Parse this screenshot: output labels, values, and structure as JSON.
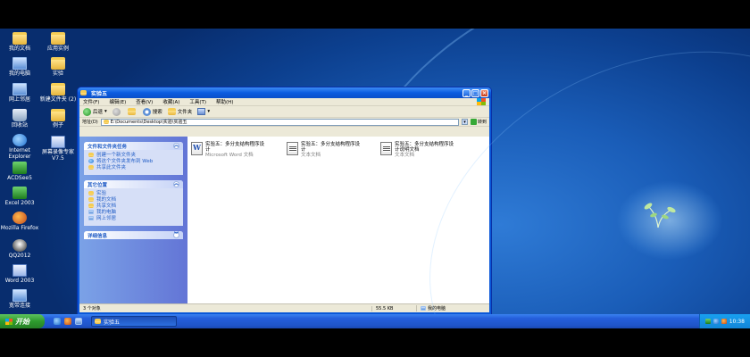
{
  "desktop": {
    "icons_col1": [
      {
        "label": "我的文档",
        "icon": "my-documents-icon"
      },
      {
        "label": "我的电脑",
        "icon": "my-computer-icon"
      },
      {
        "label": "网上邻居",
        "icon": "network-icon"
      },
      {
        "label": "回收站",
        "icon": "recycle-bin-icon"
      },
      {
        "label": "Internet Explorer",
        "icon": "ie-icon"
      },
      {
        "label": "ACDSee5",
        "icon": "acdsee-icon"
      },
      {
        "label": "Excel 2003",
        "icon": "excel-icon"
      },
      {
        "label": "Mozilla Firefox",
        "icon": "firefox-icon"
      },
      {
        "label": "QQ2012",
        "icon": "qq-icon"
      },
      {
        "label": "Word 2003",
        "icon": "word-icon"
      },
      {
        "label": "宽带连接",
        "icon": "broadband-icon"
      }
    ],
    "icons_col2": [
      {
        "label": "应用实例",
        "icon": "folder-icon"
      },
      {
        "label": "实验",
        "icon": "folder-icon"
      },
      {
        "label": "新建文件夹 (2)",
        "icon": "folder-icon"
      },
      {
        "label": "例子",
        "icon": "folder-icon"
      },
      {
        "label": "屏幕录像专家V7.5",
        "icon": "recorder-icon"
      }
    ]
  },
  "window": {
    "title": "实验五",
    "menu": [
      "文件(F)",
      "编辑(E)",
      "查看(V)",
      "收藏(A)",
      "工具(T)",
      "帮助(H)"
    ],
    "toolbar": {
      "back": "后退",
      "search": "搜索",
      "folders": "文件夹"
    },
    "address": {
      "label": "地址(D)",
      "value": "E:\\Documents\\Desktop\\实验\\实验五",
      "go": "转到"
    },
    "tasks_panel": {
      "title": "文件和文件夹任务",
      "items": [
        "创建一个新文件夹",
        "将这个文件夹发布到 Web",
        "共享此文件夹"
      ]
    },
    "places_panel": {
      "title": "其它位置",
      "items": [
        "实验",
        "我的文档",
        "共享文档",
        "我的电脑",
        "网上邻居"
      ]
    },
    "details_panel": {
      "title": "详细信息"
    },
    "files": [
      {
        "name": "实验五：多分支结构程序设计",
        "type": "Microsoft Word 文档",
        "icon": "word-doc-icon"
      },
      {
        "name": "实验五：多分支结构程序设计",
        "type": "文本文档",
        "icon": "text-doc-icon"
      },
      {
        "name": "实验五：多分支结构程序设计说明文档",
        "type": "文本文档",
        "icon": "text-doc-icon"
      }
    ],
    "status": {
      "count": "3 个对象",
      "size": "55.5 KB",
      "location": "我的电脑"
    }
  },
  "taskbar": {
    "start": "开始",
    "task": "实验五",
    "clock": "10:38"
  }
}
